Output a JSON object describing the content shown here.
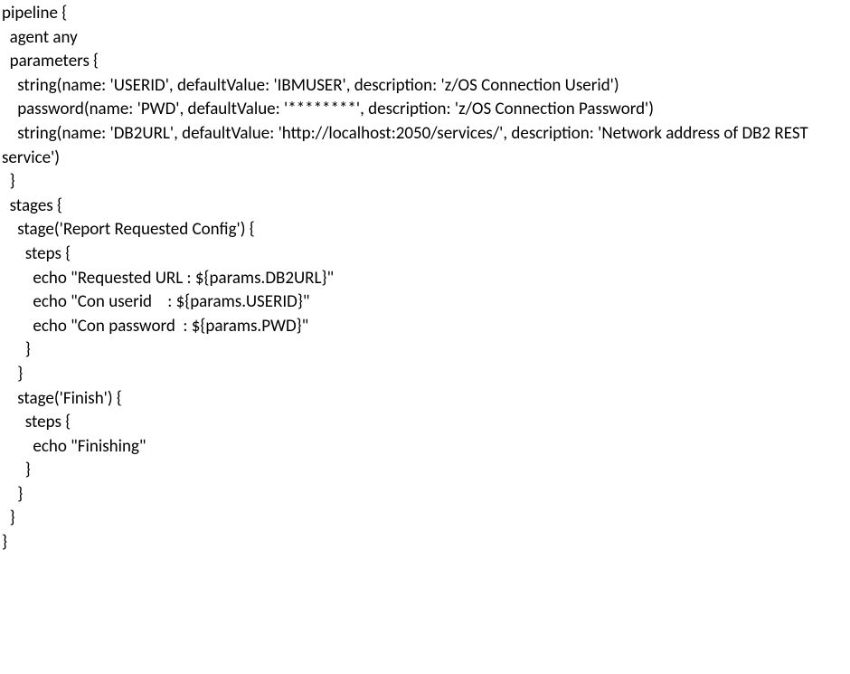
{
  "code": "pipeline {\n  agent any\n  parameters {\n    string(name: 'USERID', defaultValue: 'IBMUSER', description: 'z/OS Connection Userid')\n    password(name: 'PWD', defaultValue: '********', description: 'z/OS Connection Password')\n    string(name: 'DB2URL', defaultValue: 'http://localhost:2050/services/', description: 'Network address of DB2 REST service')\n  }\n  stages {\n    stage('Report Requested Config') {\n      steps {\n        echo \"Requested URL : ${params.DB2URL}\"\n        echo \"Con userid    : ${params.USERID}\"\n        echo \"Con password  : ${params.PWD}\"\n      }\n    }\n    stage('Finish') {\n      steps {\n        echo \"Finishing\"\n      }\n    }\n  }\n}"
}
